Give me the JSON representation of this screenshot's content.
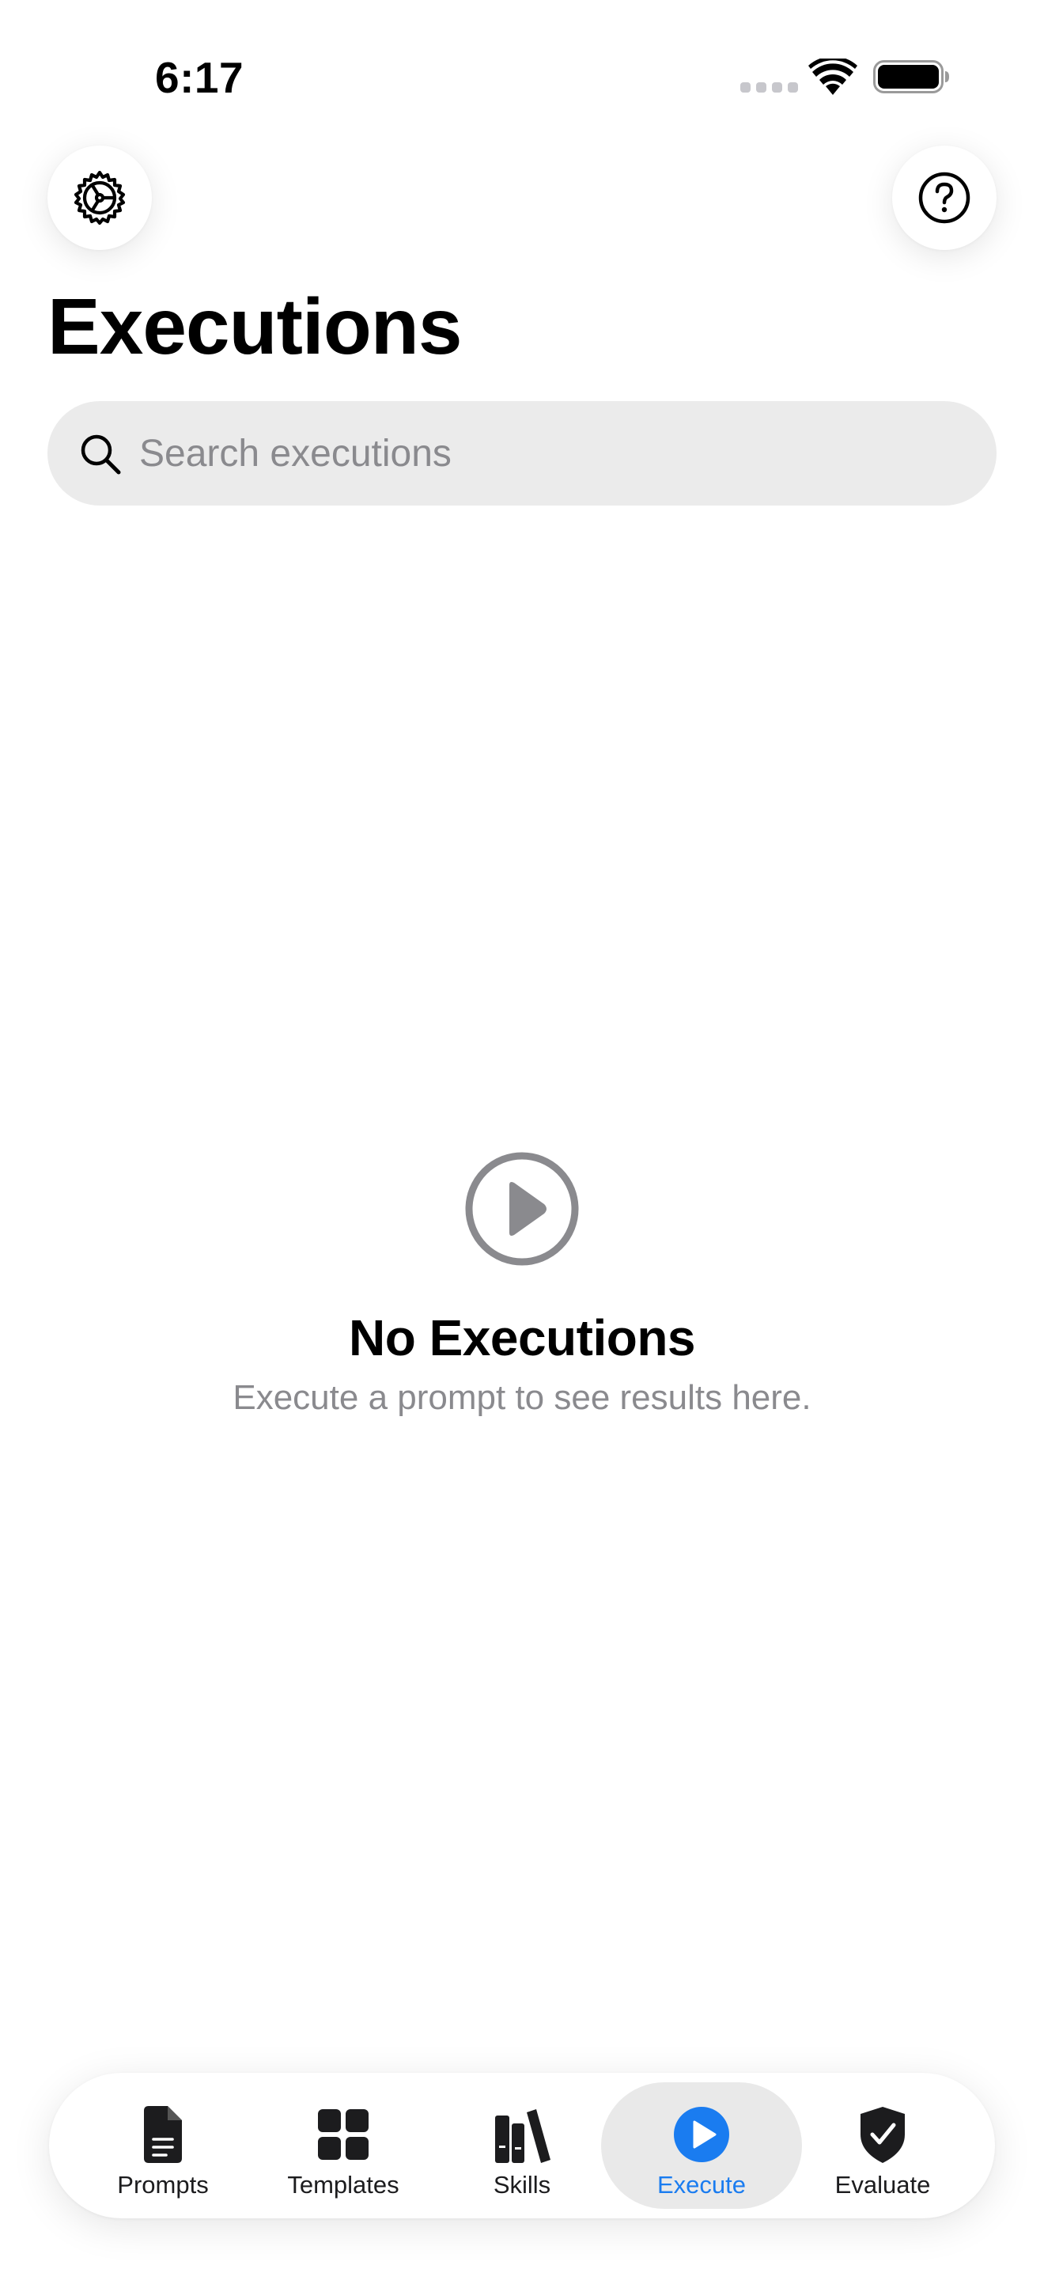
{
  "status_bar": {
    "time": "6:17"
  },
  "header": {
    "settings_icon": "gear-icon",
    "help_icon": "question-circle-icon",
    "title": "Executions"
  },
  "search": {
    "placeholder": "Search executions",
    "value": ""
  },
  "empty_state": {
    "icon": "play-circle-icon",
    "title": "No Executions",
    "subtitle": "Execute a prompt to see results here."
  },
  "tab_bar": {
    "active_color": "#1a7cf0",
    "items": [
      {
        "label": "Prompts",
        "icon": "document-icon",
        "active": false
      },
      {
        "label": "Templates",
        "icon": "grid-icon",
        "active": false
      },
      {
        "label": "Skills",
        "icon": "books-icon",
        "active": false
      },
      {
        "label": "Execute",
        "icon": "play-icon",
        "active": true
      },
      {
        "label": "Evaluate",
        "icon": "shield-check-icon",
        "active": false
      }
    ]
  }
}
